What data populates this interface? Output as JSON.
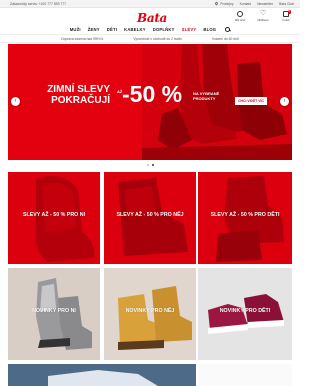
{
  "topbar": {
    "phone": "Zákaznický servis: +420 777 893 777",
    "stores": "Prodejny",
    "contact": "Kontakt",
    "newsletter": "Newsletter",
    "club": "Bata Club"
  },
  "header": {
    "logo": "Bata",
    "icons": [
      {
        "name": "account-icon",
        "label": "Můj účet"
      },
      {
        "name": "wishlist-icon",
        "label": "Oblíbené"
      },
      {
        "name": "cart-icon",
        "label": "Košík",
        "badge": "0"
      }
    ]
  },
  "nav": {
    "items": [
      "MUŽI",
      "ŽENY",
      "DĚTI",
      "KABELKY",
      "DOPLŇKY",
      "SLEVY",
      "BLOG"
    ]
  },
  "usp": [
    "Doprava zdarma nad 999 Kč",
    "Vyzvednutí v obchodě do 2 hodin",
    "Vrácení do 60 dnů"
  ],
  "hero": {
    "title": "ZIMNÍ SLEVY POKRAČUJÍ",
    "until": "AŽ",
    "percent": "-50 %",
    "products": "NA VYBRANÉ PRODUKTY",
    "cta": "CHCI VIDĚT VÍC",
    "color": "#e3000f"
  },
  "tiles": [
    {
      "label": "SLEVY AŽ - 50 % PRO NI"
    },
    {
      "label": "SLEVY AŽ - 50 % PRO NĚJ"
    },
    {
      "label": "SLEVY AŽ - 50 % PRO DĚTI"
    },
    {
      "label": "NOVINKY PRO NI"
    },
    {
      "label": "NOVINKY PRO NĚJ"
    },
    {
      "label": "NOVINKY PRO DĚTI"
    }
  ]
}
